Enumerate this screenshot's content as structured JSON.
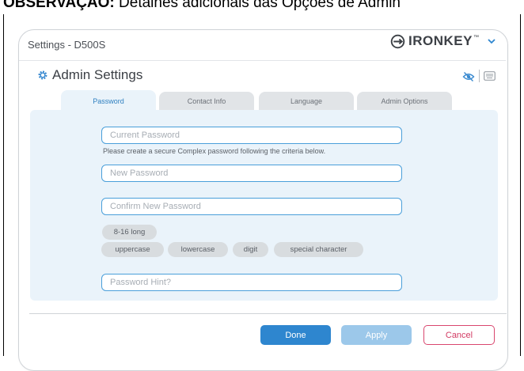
{
  "doc_caption": {
    "bold": "OBSERVAÇÃO:",
    "rest": " Detalhes adicionais das Opções de Admin"
  },
  "window": {
    "title": "Settings - D500S",
    "brand": "IRONKEY",
    "brand_tm": "™"
  },
  "section": {
    "title": "Admin Settings"
  },
  "tabs": [
    {
      "label": "Password",
      "active": true
    },
    {
      "label": "Contact Info",
      "active": false
    },
    {
      "label": "Language",
      "active": false
    },
    {
      "label": "Admin Options",
      "active": false
    }
  ],
  "form": {
    "current_password": {
      "placeholder": "Current Password",
      "value": ""
    },
    "criteria_hint": "Please create a secure Complex password following the criteria below.",
    "new_password": {
      "placeholder": "New Password",
      "value": ""
    },
    "confirm_password": {
      "placeholder": "Confirm New Password",
      "value": ""
    },
    "criteria": [
      "8-16 long",
      "uppercase",
      "lowercase",
      "digit",
      "special character"
    ],
    "password_hint": {
      "placeholder": "Password Hint?",
      "value": ""
    }
  },
  "buttons": {
    "done": "Done",
    "apply": "Apply",
    "cancel": "Cancel"
  },
  "colors": {
    "accent": "#2e86cf",
    "accent_disabled": "#9cc8ea",
    "cancel": "#d9476f",
    "panel_bg": "#eaf3fa"
  },
  "icons": {
    "section": "gear-icon",
    "toolbar": [
      "hide-password-icon",
      "keyboard-icon"
    ],
    "brand": "ironkey-logo-icon",
    "brand_menu": "chevron-down-icon"
  }
}
